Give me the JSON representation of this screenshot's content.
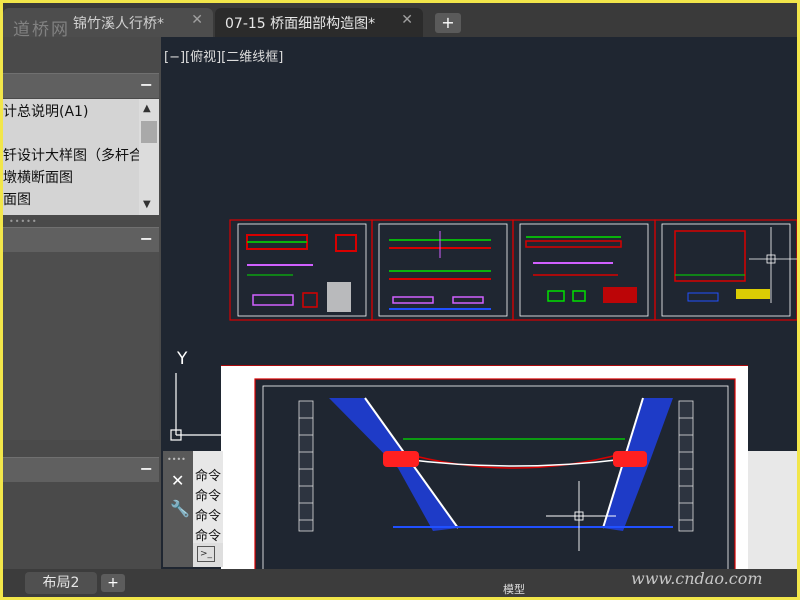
{
  "tabs": [
    {
      "label": "锦竹溪人行桥*",
      "close": "✕"
    },
    {
      "label": "07-15 桥面细部构造图*",
      "close": "✕"
    }
  ],
  "logo_text": "道桥网",
  "tab_add": "+",
  "viewport_label": "[−][俯视][二维线框]",
  "left_panel": {
    "min_symbol": "−",
    "tree_items": [
      "计总说明(A1)",
      "",
      "钎设计大样图（多杆合",
      "墩横断面图",
      "面图"
    ]
  },
  "ucs": {
    "y_label": "Y"
  },
  "command_lines": [
    "命令",
    "命令",
    "命令",
    "命令"
  ],
  "layout_tabs": {
    "label": "布局2",
    "add": "+"
  },
  "status_text": "模型",
  "watermark": "www.cndao.com",
  "colors": {
    "accent_red": "#d80000",
    "canvas": "#1f2631",
    "frame": "#f2e64a"
  }
}
